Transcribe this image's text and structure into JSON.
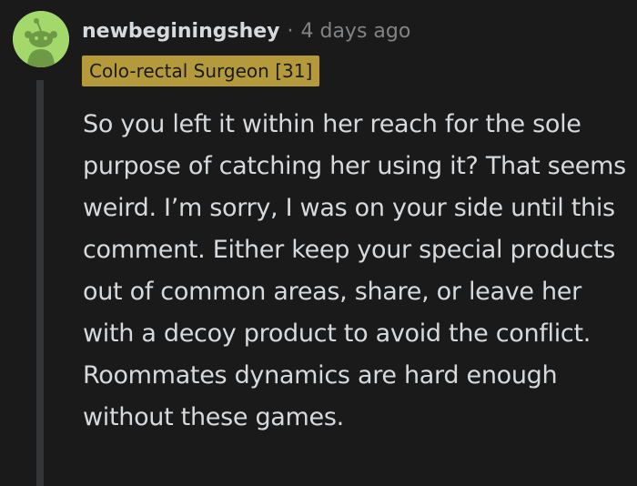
{
  "comment": {
    "username": "newbeginingshey",
    "separator": "·",
    "timestamp": "4 days ago",
    "flair": "Colo-rectal Surgeon [31]",
    "body": "So you left it within her reach for the sole purpose of catching her using it? That seems weird. I’m sorry, I was on your side until this comment. Either keep your special products out of common areas, share, or leave her with a decoy product to avoid the conflict. Roommates dynamics are hard enough without these games."
  },
  "colors": {
    "background": "#1a1a1b",
    "text": "#d7dadc",
    "muted": "#818384",
    "flair_bg": "#b59a3c",
    "avatar_bg": "#a3d86b",
    "thread_line": "#343536"
  },
  "icons": {
    "avatar": "snoo-avatar-icon"
  }
}
